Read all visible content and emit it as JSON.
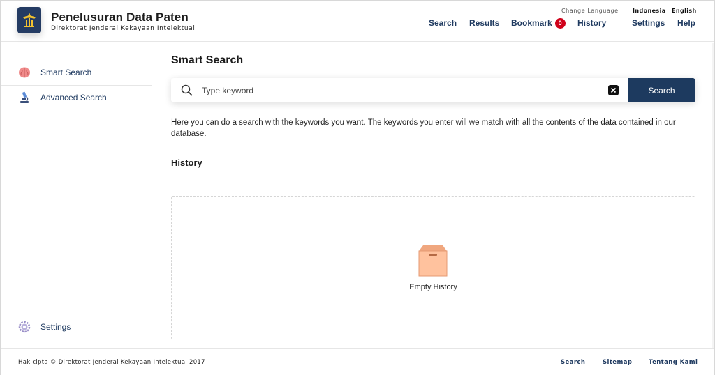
{
  "header": {
    "title": "Penelusuran Data Paten",
    "subtitle": "Direktorat Jenderal Kekayaan Intelektual",
    "nav": {
      "search": "Search",
      "results": "Results",
      "bookmark": "Bookmark",
      "bookmark_count": "0",
      "history": "History",
      "settings": "Settings",
      "help": "Help"
    },
    "change_language": "Change Language",
    "languages": [
      "Indonesia",
      "English"
    ]
  },
  "sidebar": {
    "items": [
      {
        "label": "Smart Search",
        "icon": "brain-icon"
      },
      {
        "label": "Advanced Search",
        "icon": "microscope-icon"
      },
      {
        "label": "Settings",
        "icon": "gear-icon"
      }
    ]
  },
  "main": {
    "title": "Smart Search",
    "search": {
      "placeholder": "Type keyword",
      "value": "",
      "button": "Search"
    },
    "description": "Here you can do a search with the keywords you want. The keywords you enter will we match with all the contents of the data contained in our database.",
    "history_title": "History",
    "empty_history": "Empty History"
  },
  "footer": {
    "copyright": "Hak cipta © Direktorat Jenderal Kekayaan Intelektual 2017",
    "links": [
      "Search",
      "Sitemap",
      "Tentang Kami"
    ]
  },
  "colors": {
    "primary": "#1d3a5f",
    "badge": "#d0021b",
    "brain": "#f08a8a",
    "box": "#ffc29e"
  }
}
